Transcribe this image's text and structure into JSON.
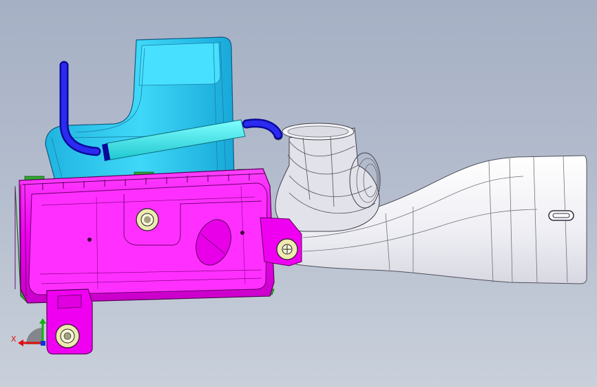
{
  "viewport": {
    "background_top": "#a6b0c4",
    "background_bottom": "#c9d0db"
  },
  "model": {
    "parts": [
      {
        "name": "resonator-tank",
        "color": "#2ccdf2"
      },
      {
        "name": "breather-hose-cyan",
        "color": "#39e6e6"
      },
      {
        "name": "breather-tube-blue",
        "color": "#1a1ad6"
      },
      {
        "name": "air-cleaner-housing",
        "color": "#f000f0"
      },
      {
        "name": "housing-seal",
        "color": "#2ea82e"
      },
      {
        "name": "intake-snorkel",
        "color": "#f4f4f8"
      },
      {
        "name": "elbow-duct",
        "color": "#e4e4ea"
      },
      {
        "name": "mount-bushing",
        "color": "#eeeab0"
      }
    ]
  },
  "triad": {
    "x_label": "X",
    "x_color": "#e01010",
    "y_color": "#10b010",
    "z_color": "#1030e0"
  }
}
